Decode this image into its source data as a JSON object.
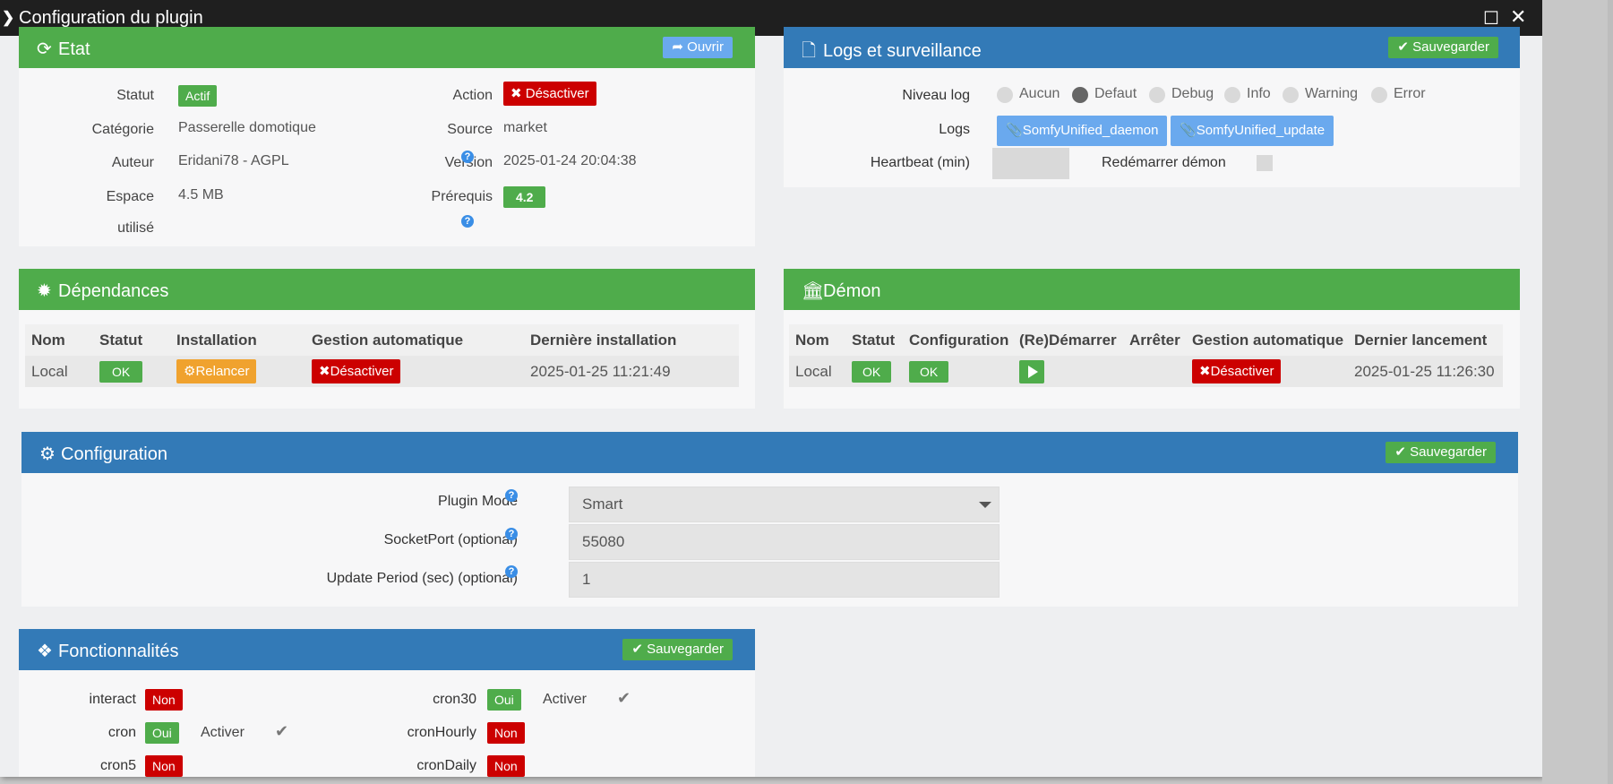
{
  "window": {
    "title": "Configuration du plugin"
  },
  "etat": {
    "title": "Etat",
    "open_label": "Ouvrir",
    "statut_label": "Statut",
    "statut_value": "Actif",
    "action_label": "Action",
    "action_value": "Désactiver",
    "categorie_label": "Catégorie",
    "categorie_value": "Passerelle domotique",
    "source_label": "Source",
    "source_value": "market",
    "auteur_label": "Auteur",
    "auteur_value": "Eridani78 - AGPL",
    "version_label": "Version",
    "version_value": "2025-01-24 20:04:38",
    "espace_label_1": "Espace",
    "espace_label_2": "utilisé",
    "espace_value": "4.5 MB",
    "prerequis_label": "Prérequis",
    "prerequis_value": "4.2"
  },
  "logs": {
    "title": "Logs et surveillance",
    "save_label": "Sauvegarder",
    "niveau_label": "Niveau log",
    "levels": [
      "Aucun",
      "Defaut",
      "Debug",
      "Info",
      "Warning",
      "Error"
    ],
    "selected_level": "Defaut",
    "logs_label": "Logs",
    "log_buttons": [
      "SomfyUnified_daemon",
      "SomfyUnified_update"
    ],
    "heartbeat_label": "Heartbeat (min)",
    "heartbeat_value": "",
    "restart_label": "Redémarrer démon"
  },
  "dependances": {
    "title": "Dépendances",
    "headers": [
      "Nom",
      "Statut",
      "Installation",
      "Gestion automatique",
      "Dernière installation"
    ],
    "row": {
      "nom": "Local",
      "statut": "OK",
      "installation": "Relancer",
      "gestion": "Désactiver",
      "derniere": "2025-01-25 11:21:49"
    }
  },
  "demon": {
    "title": "Démon",
    "headers": [
      "Nom",
      "Statut",
      "Configuration",
      "(Re)Démarrer",
      "Arrêter",
      "Gestion automatique",
      "Dernier lancement"
    ],
    "row": {
      "nom": "Local",
      "statut": "OK",
      "configuration": "OK",
      "gestion": "Désactiver",
      "dernier": "2025-01-25 11:26:30"
    }
  },
  "configuration": {
    "title": "Configuration",
    "save_label": "Sauvegarder",
    "plugin_mode_label": "Plugin Mode",
    "plugin_mode_value": "Smart",
    "socket_label": "SocketPort (optional)",
    "socket_value": "55080",
    "update_label": "Update Period (sec) (optional)",
    "update_value": "1"
  },
  "fonctionnalites": {
    "title": "Fonctionnalités",
    "save_label": "Sauvegarder",
    "activer_label": "Activer",
    "interact_label": "interact",
    "interact_value": "Non",
    "cron30_label": "cron30",
    "cron30_value": "Oui",
    "cron_label": "cron",
    "cron_value": "Oui",
    "cronHourly_label": "cronHourly",
    "cronHourly_value": "Non",
    "cron5_label": "cron5",
    "cron5_value": "Non",
    "cronDaily_label": "cronDaily",
    "cronDaily_value": "Non"
  },
  "colors": {
    "green": "#4fac4b",
    "blue": "#337ab7",
    "red": "#cc0000",
    "orange": "#f0a22e",
    "light_blue": "#6aa9ee",
    "titlebar": "#1f1f1f"
  }
}
